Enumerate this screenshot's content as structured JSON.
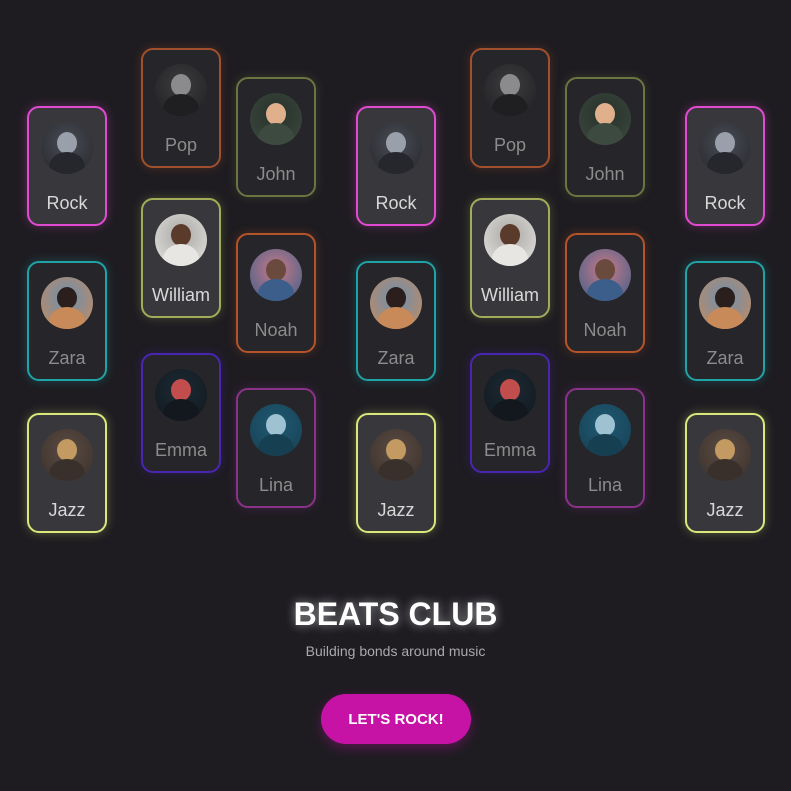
{
  "brand": {
    "title": "BEATS CLUB",
    "tagline": "Building bonds around music"
  },
  "cta": {
    "label": "LET'S ROCK!"
  },
  "colors": {
    "background": "#1e1c21",
    "cta": "#c612a5"
  },
  "cards": [
    {
      "id": "rock-1",
      "label": "Rock",
      "avatar": "rock-concert-avatar",
      "border": "#e14bd0",
      "style": "bright"
    },
    {
      "id": "zara-1",
      "label": "Zara",
      "avatar": "zara-avatar",
      "border": "#1fa3a6",
      "style": "dim"
    },
    {
      "id": "jazz-1",
      "label": "Jazz",
      "avatar": "saxophone-avatar",
      "border": "#d9e77b",
      "style": "bright"
    },
    {
      "id": "pop-1",
      "label": "Pop",
      "avatar": "pop-crowd-avatar",
      "border": "#a1502d",
      "style": "dim"
    },
    {
      "id": "william-1",
      "label": "William",
      "avatar": "william-avatar",
      "border": "#a3ad59",
      "style": "bright"
    },
    {
      "id": "emma-1",
      "label": "Emma",
      "avatar": "emma-avatar",
      "border": "#4a25b0",
      "style": "dim"
    },
    {
      "id": "john-1",
      "label": "John",
      "avatar": "john-avatar",
      "border": "#6b7541",
      "style": "dim"
    },
    {
      "id": "noah-1",
      "label": "Noah",
      "avatar": "noah-avatar",
      "border": "#b5542a",
      "style": "dim"
    },
    {
      "id": "lina-1",
      "label": "Lina",
      "avatar": "lina-avatar",
      "border": "#8b3389",
      "style": "dim"
    },
    {
      "id": "rock-2",
      "label": "Rock",
      "avatar": "rock-concert-avatar",
      "border": "#e14bd0",
      "style": "bright"
    },
    {
      "id": "zara-2",
      "label": "Zara",
      "avatar": "zara-avatar",
      "border": "#1fa3a6",
      "style": "dim"
    },
    {
      "id": "jazz-2",
      "label": "Jazz",
      "avatar": "saxophone-avatar",
      "border": "#d9e77b",
      "style": "bright"
    },
    {
      "id": "pop-2",
      "label": "Pop",
      "avatar": "pop-crowd-avatar",
      "border": "#a1502d",
      "style": "dim"
    },
    {
      "id": "william-2",
      "label": "William",
      "avatar": "william-avatar",
      "border": "#a3ad59",
      "style": "bright"
    },
    {
      "id": "emma-2",
      "label": "Emma",
      "avatar": "emma-avatar",
      "border": "#4a25b0",
      "style": "dim"
    },
    {
      "id": "john-2",
      "label": "John",
      "avatar": "john-avatar",
      "border": "#6b7541",
      "style": "dim"
    },
    {
      "id": "noah-2",
      "label": "Noah",
      "avatar": "noah-avatar",
      "border": "#b5542a",
      "style": "dim"
    },
    {
      "id": "lina-2",
      "label": "Lina",
      "avatar": "lina-avatar",
      "border": "#8b3389",
      "style": "dim"
    },
    {
      "id": "rock-3",
      "label": "Rock",
      "avatar": "rock-concert-avatar",
      "border": "#e14bd0",
      "style": "bright"
    },
    {
      "id": "zara-3",
      "label": "Zara",
      "avatar": "zara-avatar",
      "border": "#1fa3a6",
      "style": "dim"
    },
    {
      "id": "jazz-3",
      "label": "Jazz",
      "avatar": "saxophone-avatar",
      "border": "#d9e77b",
      "style": "bright"
    }
  ]
}
